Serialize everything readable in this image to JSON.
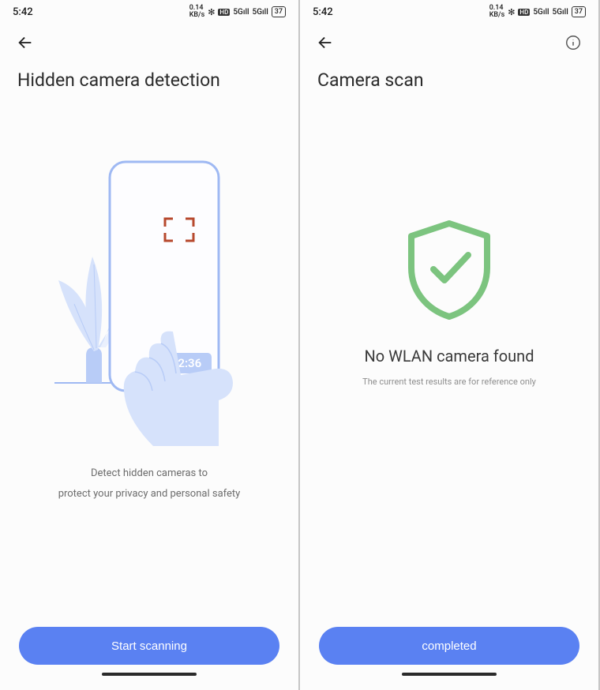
{
  "status": {
    "time": "5:42",
    "kbs": "0.14",
    "kbs_unit": "KB/s",
    "hd": "HD",
    "signal1": "5G",
    "signal2": "5G",
    "battery": "37"
  },
  "left": {
    "title": "Hidden camera detection",
    "illustration_time": "02:36",
    "desc_line1": "Detect hidden cameras to",
    "desc_line2": "protect your privacy and personal safety",
    "button": "Start scanning"
  },
  "right": {
    "title": "Camera scan",
    "result_title": "No WLAN camera found",
    "result_sub": "The current test results are for reference only",
    "button": "completed"
  },
  "colors": {
    "primary": "#5a81f2",
    "shield": "#7cc47f",
    "illus_light": "#d6e2fb",
    "illus_mid": "#b8ccf7",
    "illus_stroke": "#9fb9f3",
    "crosshair": "#b7492e"
  }
}
